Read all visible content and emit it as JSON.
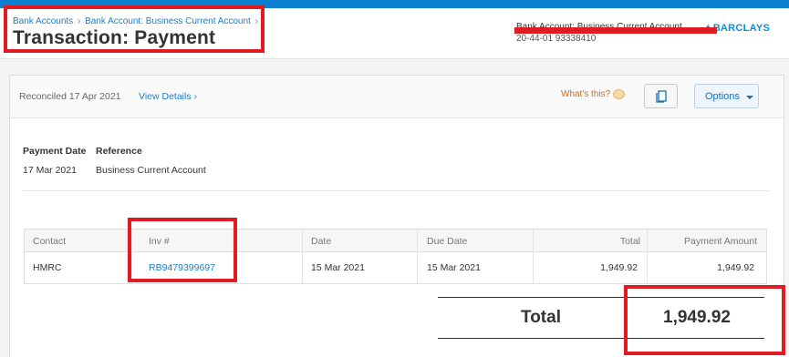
{
  "header": {
    "breadcrumb": [
      "Bank Accounts",
      "Bank Account: Business Current Account"
    ],
    "breadcrumb_separator": "›",
    "title": "Transaction: Payment",
    "account_name": "Bank Account: Business Current Account",
    "account_number": "20-44-01 93338410",
    "bank_logo": "BARCLAYS"
  },
  "status": {
    "reconciled": "Reconciled 17 Apr 2021",
    "view_details": "View Details ›",
    "whats_this": "What's this?",
    "options_label": "Options"
  },
  "summary": {
    "payment_date_label": "Payment Date",
    "payment_date": "17 Mar 2021",
    "reference_label": "Reference",
    "reference": "Business Current Account"
  },
  "table": {
    "columns": [
      "Contact",
      "Inv #",
      "Date",
      "Due Date",
      "Total",
      "Payment Amount"
    ],
    "rows": [
      {
        "contact": "HMRC",
        "inv": "RB9479399697",
        "date": "15 Mar 2021",
        "due_date": "15 Mar 2021",
        "total": "1,949.92",
        "payment_amount": "1,949.92"
      }
    ]
  },
  "totals": {
    "label": "Total",
    "value": "1,949.92"
  },
  "colors": {
    "accent": "#0a7fd0",
    "link": "#1a7fc4",
    "annotation": "#e01b24",
    "hint": "#cc6a1e"
  }
}
